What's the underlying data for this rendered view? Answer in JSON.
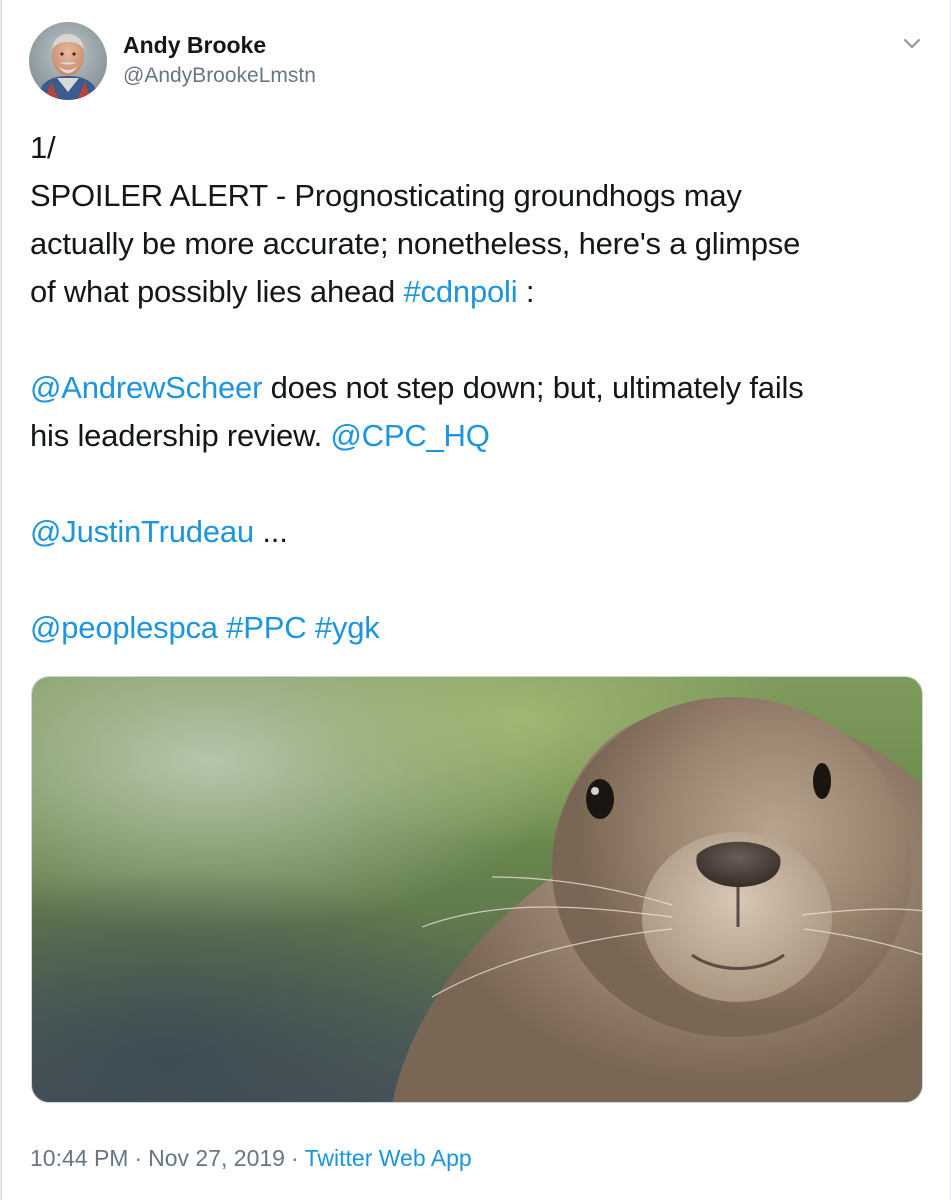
{
  "author": {
    "display_name": "Andy Brooke",
    "handle": "@AndyBrookeLmstn"
  },
  "tweet": {
    "line_1": "1/",
    "line_2": "SPOILER ALERT - Prognosticating groundhogs may",
    "line_3": "actually be more accurate; nonetheless, here's a glimpse",
    "line_4_text": "of what possibly lies ahead ",
    "hashtag_cdnpoli": "#cdnpoli",
    "line_4_tail": " :",
    "mention_andrewscheer": "@AndrewScheer",
    "line_5_text": " does not step down; but, ultimately fails",
    "line_6_text": "his leadership review. ",
    "mention_cpc_hq": "@CPC_HQ",
    "mention_justintrudeau": "@JustinTrudeau",
    "line_7_tail": " ...",
    "mention_peoplespca": "@peoplespca",
    "hashtag_ppc": "#PPC",
    "hashtag_ygk": "#ygk"
  },
  "meta": {
    "time": "10:44 PM",
    "separator": "·",
    "date": "Nov 27, 2019",
    "source": "Twitter Web App"
  },
  "colors": {
    "link": "#1b95e0",
    "secondary_text": "#657786",
    "primary_text": "#14171a"
  },
  "icons": {
    "menu": "chevron-down-icon"
  }
}
